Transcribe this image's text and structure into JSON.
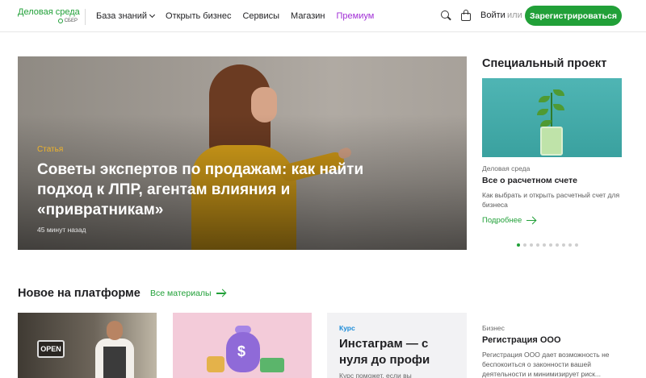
{
  "header": {
    "logo_title": "Деловая среда",
    "logo_sub": "СБЕР",
    "nav": [
      {
        "label": "База знаний",
        "dropdown": true
      },
      {
        "label": "Открыть бизнес"
      },
      {
        "label": "Сервисы"
      },
      {
        "label": "Магазин"
      },
      {
        "label": "Премиум"
      }
    ],
    "login": "Войти",
    "or": "или",
    "register": "Зарегистрироваться",
    "colors": {
      "accent": "#21a038",
      "premium": "#a12fd6"
    }
  },
  "hero": {
    "tag": "Статья",
    "title": "Советы экспертов по продажам: как найти подход к ЛПР, агентам влияния и «привратникам»",
    "time": "45 минут назад"
  },
  "special_project": {
    "heading": "Специальный проект",
    "source": "Деловая среда",
    "title": "Все о расчетном счете",
    "description": "Как выбрать и открыть расчетный счет для бизнеса",
    "more": "Подробнее",
    "slides_total": 10,
    "slide_active": 1
  },
  "new_on_platform": {
    "heading": "Новое на платформе",
    "all_materials": "Все материалы",
    "cards": [
      {
        "image_text": "OPEN"
      },
      {
        "image_icon": "money-bag-icon"
      },
      {
        "tag": "Курс",
        "title": "Инстаграм — с нуля до профи",
        "description": "Курс поможет, если вы"
      },
      {
        "source": "Бизнес",
        "title": "Регистрация ООО",
        "description": "Регистрация ООО дает возможность не беспокоиться о законности вашей деятельности и минимизирует риск..."
      }
    ]
  }
}
